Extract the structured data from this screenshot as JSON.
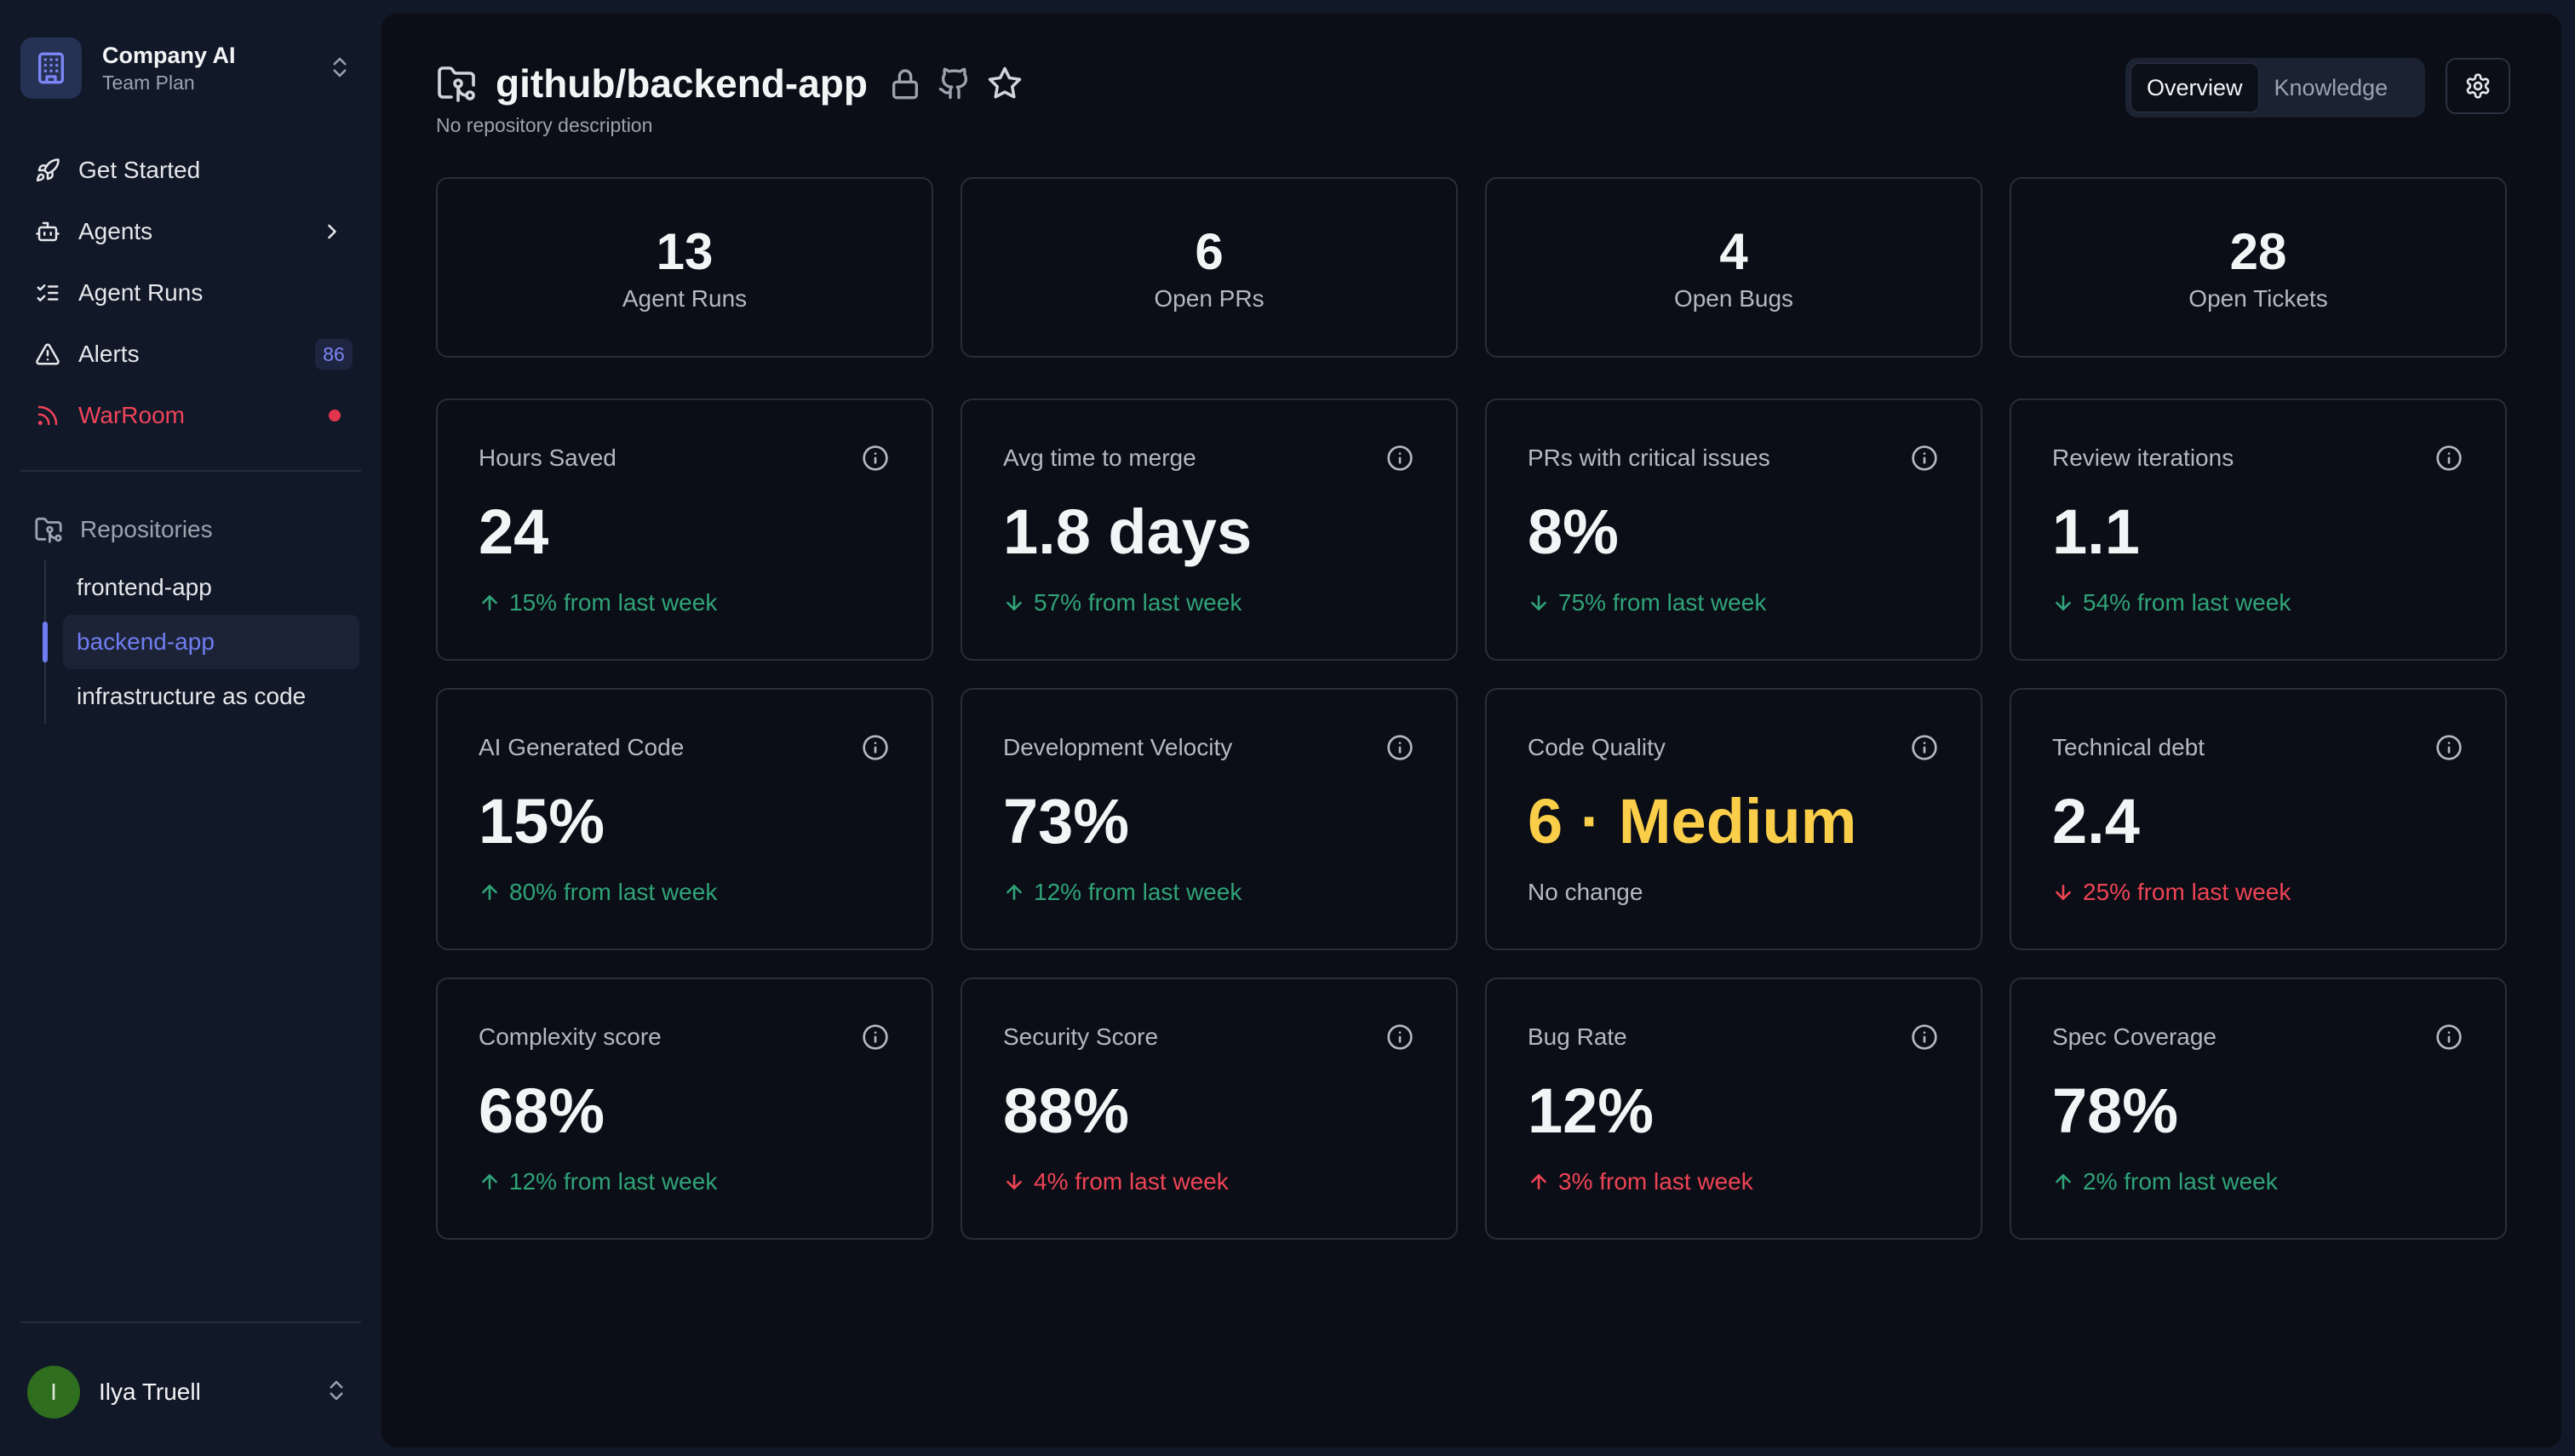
{
  "workspace": {
    "name": "Company AI",
    "plan": "Team Plan"
  },
  "nav": {
    "get_started": "Get Started",
    "agents": "Agents",
    "agent_runs": "Agent Runs",
    "alerts": "Alerts",
    "alerts_count": "86",
    "warroom": "WarRoom"
  },
  "repositories": {
    "heading": "Repositories",
    "items": [
      "frontend-app",
      "backend-app",
      "infrastructure as code"
    ],
    "active": "backend-app"
  },
  "user": {
    "initial": "I",
    "name": "Ilya Truell"
  },
  "header": {
    "title": "github/backend-app",
    "description": "No repository description",
    "tabs": [
      "Overview",
      "Knowledge"
    ],
    "active_tab": "Overview"
  },
  "stats": [
    {
      "value": "13",
      "label": "Agent Runs"
    },
    {
      "value": "6",
      "label": "Open PRs"
    },
    {
      "value": "4",
      "label": "Open Bugs"
    },
    {
      "value": "28",
      "label": "Open Tickets"
    }
  ],
  "metrics": [
    {
      "title": "Hours Saved",
      "value": "24",
      "change": "15% from last week",
      "direction": "up",
      "tone": "good"
    },
    {
      "title": "Avg time to merge",
      "value": "1.8 days",
      "change": "57% from last week",
      "direction": "down",
      "tone": "good"
    },
    {
      "title": "PRs with critical issues",
      "value": "8%",
      "change": "75% from last week",
      "direction": "down",
      "tone": "good"
    },
    {
      "title": "Review iterations",
      "value": "1.1",
      "change": "54% from last week",
      "direction": "down",
      "tone": "good"
    },
    {
      "title": "AI Generated Code",
      "value": "15%",
      "change": "80% from last week",
      "direction": "up",
      "tone": "good"
    },
    {
      "title": "Development Velocity",
      "value": "73%",
      "change": "12% from last week",
      "direction": "up",
      "tone": "good"
    },
    {
      "title": "Code Quality",
      "value": "6 · Medium",
      "change": "No change",
      "direction": "none",
      "tone": "neutral",
      "value_color": "#fbce4a"
    },
    {
      "title": "Technical debt",
      "value": "2.4",
      "change": "25% from last week",
      "direction": "down",
      "tone": "bad"
    },
    {
      "title": "Complexity score",
      "value": "68%",
      "change": "12% from last week",
      "direction": "up",
      "tone": "good"
    },
    {
      "title": "Security Score",
      "value": "88%",
      "change": "4% from last week",
      "direction": "down",
      "tone": "bad"
    },
    {
      "title": "Bug Rate",
      "value": "12%",
      "change": "3% from last week",
      "direction": "up",
      "tone": "bad"
    },
    {
      "title": "Spec Coverage",
      "value": "78%",
      "change": "2% from last week",
      "direction": "up",
      "tone": "good"
    }
  ],
  "colors": {
    "accent": "#6f7df0",
    "good": "#30a378",
    "bad": "#ef4455",
    "warning": "#fbce4a",
    "avatar": "#2f6d1f"
  }
}
